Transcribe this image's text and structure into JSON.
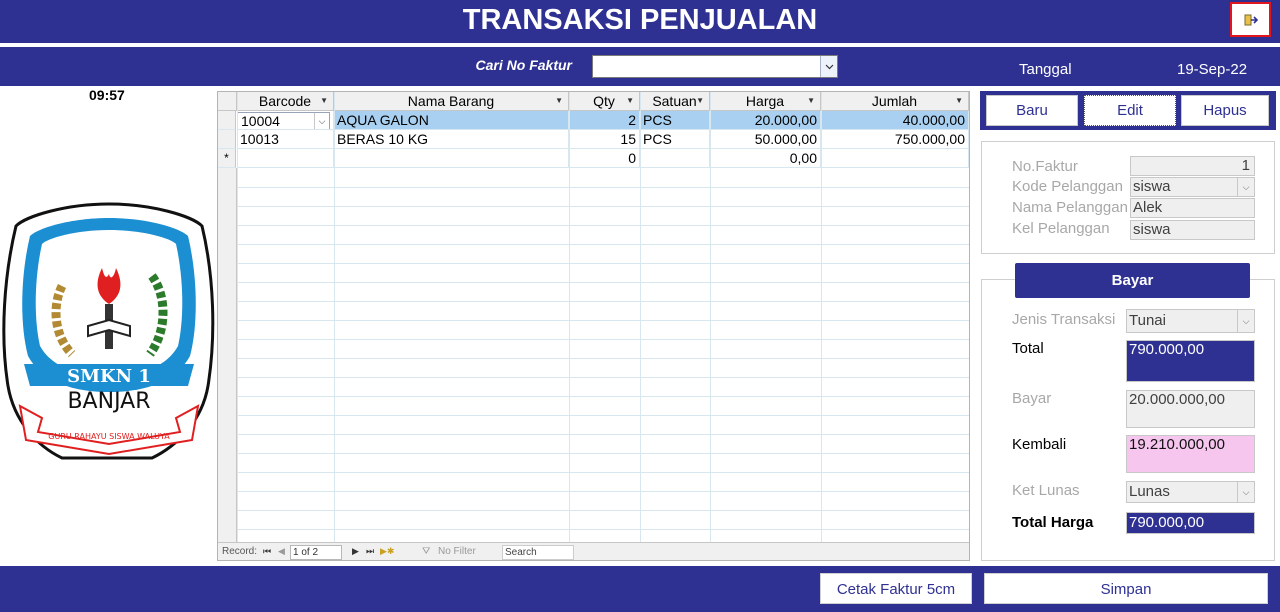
{
  "header": {
    "title": "TRANSAKSI PENJUALAN",
    "exit_icon": "exit-door-icon"
  },
  "search": {
    "label": "Cari No Faktur",
    "value": ""
  },
  "date": {
    "label": "Tanggal",
    "value": "19-Sep-22"
  },
  "clock": "09:57",
  "logo": {
    "school": "SMKN 1",
    "city": "BANJAR",
    "motto": "GURU RAHAYU SISWA WALUYA"
  },
  "grid": {
    "columns": [
      "Barcode",
      "Nama Barang",
      "Qty",
      "Satuan",
      "Harga",
      "Jumlah"
    ],
    "rows": [
      {
        "barcode": "10004",
        "nama": "AQUA GALON",
        "qty": "2",
        "satuan": "PCS",
        "harga": "20.000,00",
        "jumlah": "40.000,00"
      },
      {
        "barcode": "10013",
        "nama": "BERAS 10 KG",
        "qty": "15",
        "satuan": "PCS",
        "harga": "50.000,00",
        "jumlah": "750.000,00"
      }
    ],
    "new_row": {
      "marker": "*",
      "qty": "0",
      "harga": "0,00"
    },
    "nav": {
      "record_label": "Record:",
      "position": "1 of 2",
      "filter": "No Filter",
      "search": "Search"
    }
  },
  "actions": {
    "baru": "Baru",
    "edit": "Edit",
    "hapus": "Hapus"
  },
  "info": {
    "no_faktur": {
      "label": "No.Faktur",
      "value": "1"
    },
    "kode_pelanggan": {
      "label": "Kode Pelanggan",
      "value": "siswa"
    },
    "nama_pelanggan": {
      "label": "Nama Pelanggan",
      "value": "Alek"
    },
    "kel_pelanggan": {
      "label": "Kel Pelanggan",
      "value": "siswa"
    }
  },
  "payment": {
    "heading": "Bayar",
    "jenis_transaksi": {
      "label": "Jenis Transaksi",
      "value": "Tunai"
    },
    "total": {
      "label": "Total",
      "value": "790.000,00"
    },
    "bayar": {
      "label": "Bayar",
      "value": "20.000.000,00"
    },
    "kembali": {
      "label": "Kembali",
      "value": "19.210.000,00"
    },
    "ket_lunas": {
      "label": "Ket Lunas",
      "value": "Lunas"
    },
    "total_harga": {
      "label": "Total Harga",
      "value": "790.000,00"
    }
  },
  "footer": {
    "cetak": "Cetak Faktur 5cm",
    "simpan": "Simpan"
  },
  "colors": {
    "brand": "#2e3192",
    "selected_row": "#a9d0f0",
    "kembali_bg": "#f7c6ef",
    "exit_border": "#e0161e"
  }
}
